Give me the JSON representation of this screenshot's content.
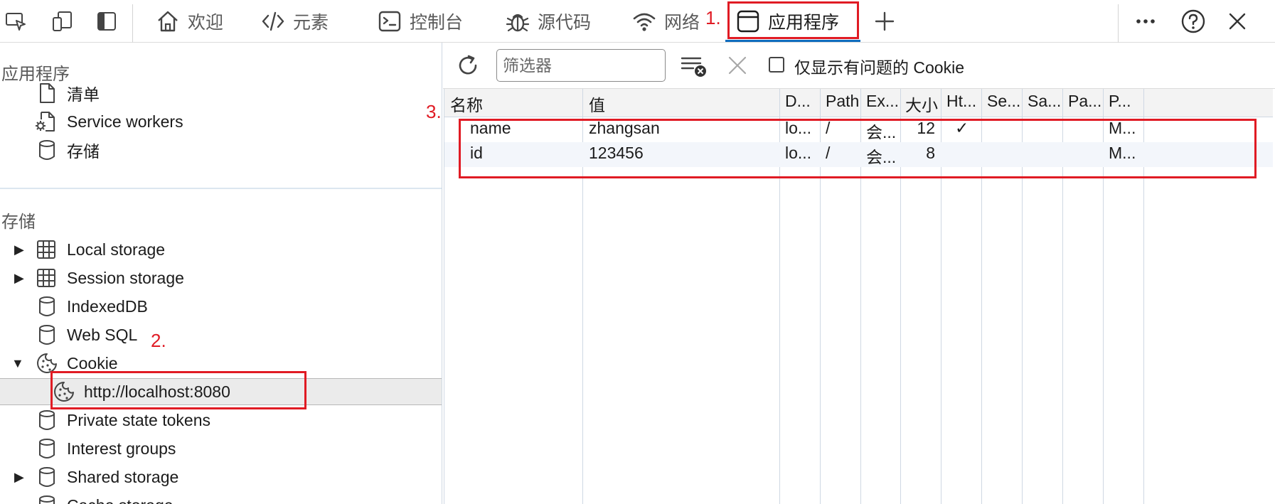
{
  "topbar": {
    "tabs": [
      {
        "label": "欢迎",
        "icon": "home-icon"
      },
      {
        "label": "元素",
        "icon": "code-icon"
      },
      {
        "label": "控制台",
        "icon": "console-icon"
      },
      {
        "label": "源代码",
        "icon": "bug-icon"
      },
      {
        "label": "网络",
        "icon": "wifi-icon"
      },
      {
        "label": "应用程序",
        "icon": "window-icon",
        "active": true
      }
    ],
    "add_tab_label": "+",
    "more_label": "···",
    "help_label": "?",
    "close_label": "✕"
  },
  "left": {
    "app_section_title": "应用程序",
    "app_items": [
      {
        "label": "清单",
        "icon": "document-icon"
      },
      {
        "label": "Service workers",
        "icon": "gear-document-icon"
      },
      {
        "label": "存储",
        "icon": "database-icon"
      }
    ],
    "storage_section_title": "存储",
    "storage_items": [
      {
        "label": "Local storage",
        "icon": "table-icon",
        "arrow": "▶"
      },
      {
        "label": "Session storage",
        "icon": "table-icon",
        "arrow": "▶"
      },
      {
        "label": "IndexedDB",
        "icon": "database-icon"
      },
      {
        "label": "Web SQL",
        "icon": "database-icon"
      },
      {
        "label": "Cookie",
        "icon": "cookie-icon",
        "arrow": "▼"
      },
      {
        "label": "http://localhost:8080",
        "icon": "cookie-icon",
        "selected": true
      },
      {
        "label": "Private state tokens",
        "icon": "database-icon"
      },
      {
        "label": "Interest groups",
        "icon": "database-icon"
      },
      {
        "label": "Shared storage",
        "icon": "database-icon",
        "arrow": "▶"
      },
      {
        "label": "Cache storage",
        "icon": "database-icon"
      }
    ]
  },
  "toolbar": {
    "filter_placeholder": "筛选器",
    "checkbox_label": "仅显示有问题的 Cookie"
  },
  "table": {
    "headers": [
      "名称",
      "值",
      "D...",
      "Path",
      "Ex...",
      "大小",
      "Ht...",
      "Se...",
      "Sa...",
      "Pa...",
      "P..."
    ],
    "rows": [
      [
        "name",
        "zhangsan",
        "lo...",
        "/",
        "会...",
        "12",
        "✓",
        "",
        "",
        "",
        "M..."
      ],
      [
        "id",
        "123456",
        "lo...",
        "/",
        "会...",
        "8",
        "",
        "",
        "",
        "",
        "M..."
      ]
    ]
  },
  "annotations": {
    "step1": "1.",
    "step2": "2.",
    "step3": "3."
  },
  "colors": {
    "accent": "#0f6cbd",
    "annotation": "#e01b24",
    "selected_row": "#ebebeb"
  }
}
